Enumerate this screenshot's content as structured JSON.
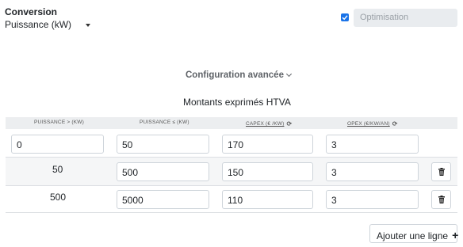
{
  "conversion": {
    "label": "Conversion",
    "selected": "Puissance (kW)"
  },
  "optimisation": {
    "checked": true,
    "placeholder": "Optimisation"
  },
  "advanced": {
    "label": "Configuration avancée"
  },
  "table": {
    "subtitle": "Montants exprimés HTVA",
    "headers": {
      "min": "PUISSANCE > (KW)",
      "max": "PUISSANCE ≤ (KW)",
      "capex": "CAPEX (€ /KW)",
      "opex": "OPEX (€/KW/AN)"
    },
    "rows": [
      {
        "min": "0",
        "max": "50",
        "capex": "170",
        "opex": "3"
      },
      {
        "min": "50",
        "max": "500",
        "capex": "150",
        "opex": "3"
      },
      {
        "min": "500",
        "max": "5000",
        "capex": "110",
        "opex": "3"
      }
    ],
    "add_label": "Ajouter une ligne",
    "colors": {
      "accent": "#1a73e8",
      "header_bg": "#eceef0",
      "row_alt_bg": "#f5f6f7"
    }
  }
}
